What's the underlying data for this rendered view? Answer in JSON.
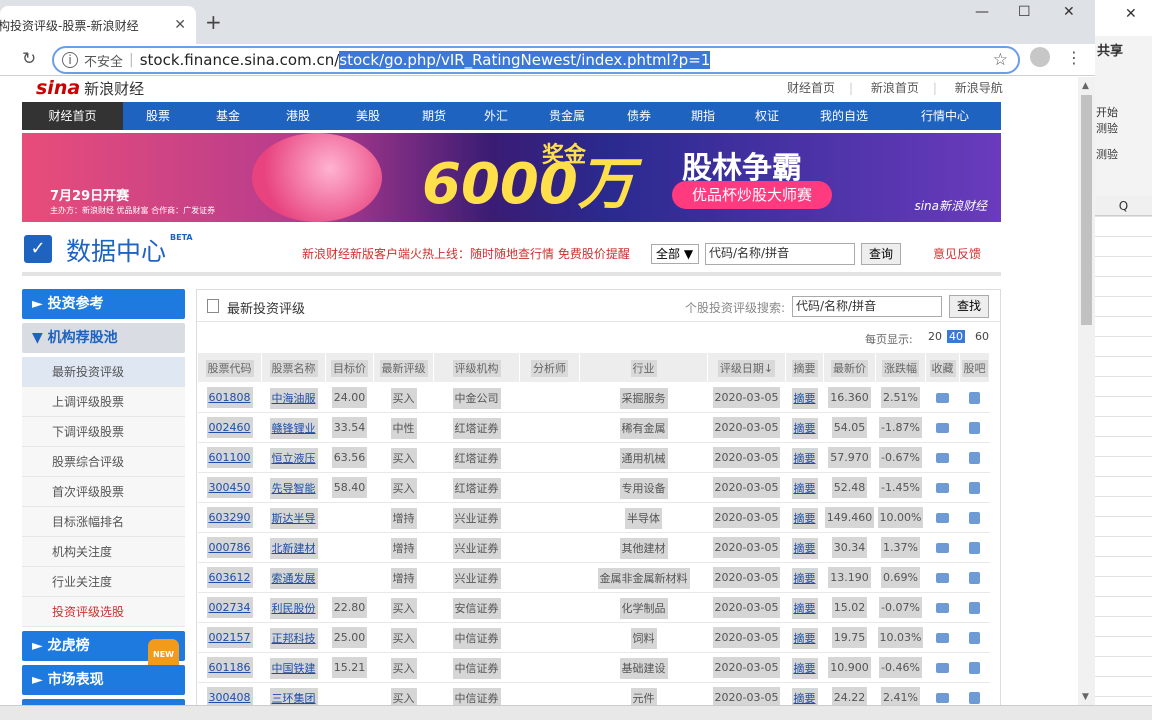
{
  "browser": {
    "tab_title": "构投资评级-股票-新浪财经",
    "tab_close": "✕",
    "new_tab": "+",
    "minimize": "—",
    "maximize": "☐",
    "close": "✕",
    "insecure_label": "不安全",
    "url_host": "stock.finance.sina.com.cn/",
    "url_path": "stock/go.php/vIR_RatingNewest/index.phtml?p=1"
  },
  "excel": {
    "share": "共享",
    "texts": [
      "开始",
      "测验",
      "测验"
    ],
    "column": "Q"
  },
  "header": {
    "logo_text": "sina",
    "logo_cn": "新浪财经",
    "top_links": [
      "财经首页",
      "新浪首页",
      "新浪导航"
    ]
  },
  "navbar": [
    "财经首页",
    "股票",
    "基金",
    "港股",
    "美股",
    "期货",
    "外汇",
    "贵金属",
    "债券",
    "期指",
    "权证",
    "我的自选",
    "行情中心"
  ],
  "banner": {
    "date": "7月29日开赛",
    "sponsor": "主办方：新浪财经 优品财富 合作商：广发证券",
    "amount": "6000万",
    "prize": "奖金",
    "title": "股林争霸",
    "subtitle": "优品杯炒股大师赛",
    "logo": "sina新浪财经"
  },
  "datacenter": {
    "title": "数据中心",
    "beta": "BETA",
    "promo": "新浪财经新版客户端火热上线：随时随地查行情 免费股价提醒",
    "select_value": "全部 ▼",
    "input_value": "代码/名称/拼音",
    "query_btn": "查询",
    "feedback": "意见反馈"
  },
  "sidebar": {
    "sections": [
      {
        "label": "► 投资参考",
        "style": "blue"
      },
      {
        "label": "▼ 机构荐股池",
        "style": "grey"
      }
    ],
    "items": [
      {
        "label": "最新投资评级",
        "state": "sel"
      },
      {
        "label": "上调评级股票",
        "state": ""
      },
      {
        "label": "下调评级股票",
        "state": ""
      },
      {
        "label": "股票综合评级",
        "state": ""
      },
      {
        "label": "首次评级股票",
        "state": ""
      },
      {
        "label": "目标涨幅排名",
        "state": ""
      },
      {
        "label": "机构关注度",
        "state": ""
      },
      {
        "label": "行业关注度",
        "state": ""
      },
      {
        "label": "投资评级选股",
        "state": "red"
      }
    ],
    "bottom": [
      {
        "label": "► 龙虎榜",
        "badge": "NEW"
      },
      {
        "label": "► 市场表现",
        "badge": ""
      },
      {
        "label": "► 财务分析",
        "badge": ""
      }
    ]
  },
  "panel": {
    "title": "最新投资评级",
    "search_label": "个股投资评级搜索:",
    "search_value": "代码/名称/拼音",
    "search_btn": "查找",
    "per_page_label": "每页显示:",
    "per_page_options": [
      "20",
      "40",
      "60"
    ],
    "per_page_selected": "40"
  },
  "table": {
    "columns": [
      "股票代码",
      "股票名称",
      "目标价",
      "最新评级",
      "评级机构",
      "分析师",
      "行业",
      "评级日期↓",
      "摘要",
      "最新价",
      "涨跌幅",
      "收藏",
      "股吧"
    ],
    "rows": [
      [
        "601808",
        "中海油服",
        "24.00",
        "买入",
        "中金公司",
        "",
        "采掘服务",
        "2020-03-05",
        "摘要",
        "16.360",
        "2.51%"
      ],
      [
        "002460",
        "赣锋锂业",
        "33.54",
        "中性",
        "红塔证券",
        "",
        "稀有金属",
        "2020-03-05",
        "摘要",
        "54.05",
        "-1.87%"
      ],
      [
        "601100",
        "恒立液压",
        "63.56",
        "买入",
        "红塔证券",
        "",
        "通用机械",
        "2020-03-05",
        "摘要",
        "57.970",
        "-0.67%"
      ],
      [
        "300450",
        "先导智能",
        "58.40",
        "买入",
        "红塔证券",
        "",
        "专用设备",
        "2020-03-05",
        "摘要",
        "52.48",
        "-1.45%"
      ],
      [
        "603290",
        "斯达半导",
        "",
        "增持",
        "兴业证券",
        "",
        "半导体",
        "2020-03-05",
        "摘要",
        "149.460",
        "10.00%"
      ],
      [
        "000786",
        "北新建材",
        "",
        "增持",
        "兴业证券",
        "",
        "其他建材",
        "2020-03-05",
        "摘要",
        "30.34",
        "1.37%"
      ],
      [
        "603612",
        "索通发展",
        "",
        "增持",
        "兴业证券",
        "",
        "金属非金属新材料",
        "2020-03-05",
        "摘要",
        "13.190",
        "0.69%"
      ],
      [
        "002734",
        "利民股份",
        "22.80",
        "买入",
        "安信证券",
        "",
        "化学制品",
        "2020-03-05",
        "摘要",
        "15.02",
        "-0.07%"
      ],
      [
        "002157",
        "正邦科技",
        "25.00",
        "买入",
        "中信证券",
        "",
        "饲料",
        "2020-03-05",
        "摘要",
        "19.75",
        "10.03%"
      ],
      [
        "601186",
        "中国铁建",
        "15.21",
        "买入",
        "中信证券",
        "",
        "基础建设",
        "2020-03-05",
        "摘要",
        "10.900",
        "-0.46%"
      ],
      [
        "300408",
        "三环集团",
        "",
        "买入",
        "中信证券",
        "",
        "元件",
        "2020-03-05",
        "摘要",
        "24.22",
        "2.41%"
      ]
    ]
  }
}
